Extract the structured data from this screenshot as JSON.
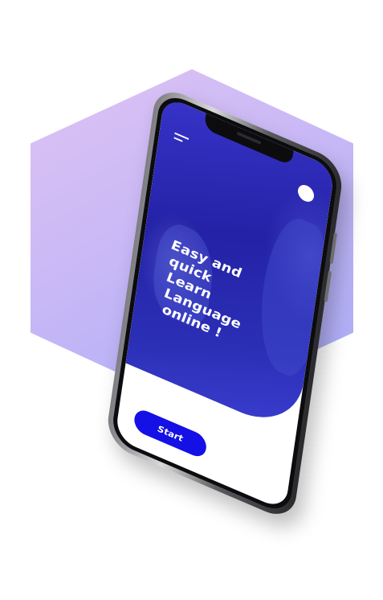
{
  "app": {
    "headline_lines": [
      "Easy and",
      "quick",
      "Learn",
      "Language",
      "online !"
    ],
    "start_label": "Start"
  },
  "icons": {
    "menu": "hamburger-menu-icon",
    "profile": "avatar-circle"
  },
  "colors": {
    "hexagon_top": "#dec3f3",
    "hexagon_bottom": "#a7abf6",
    "hero_blue": "#2422a6",
    "start_button": "#1410e6"
  }
}
